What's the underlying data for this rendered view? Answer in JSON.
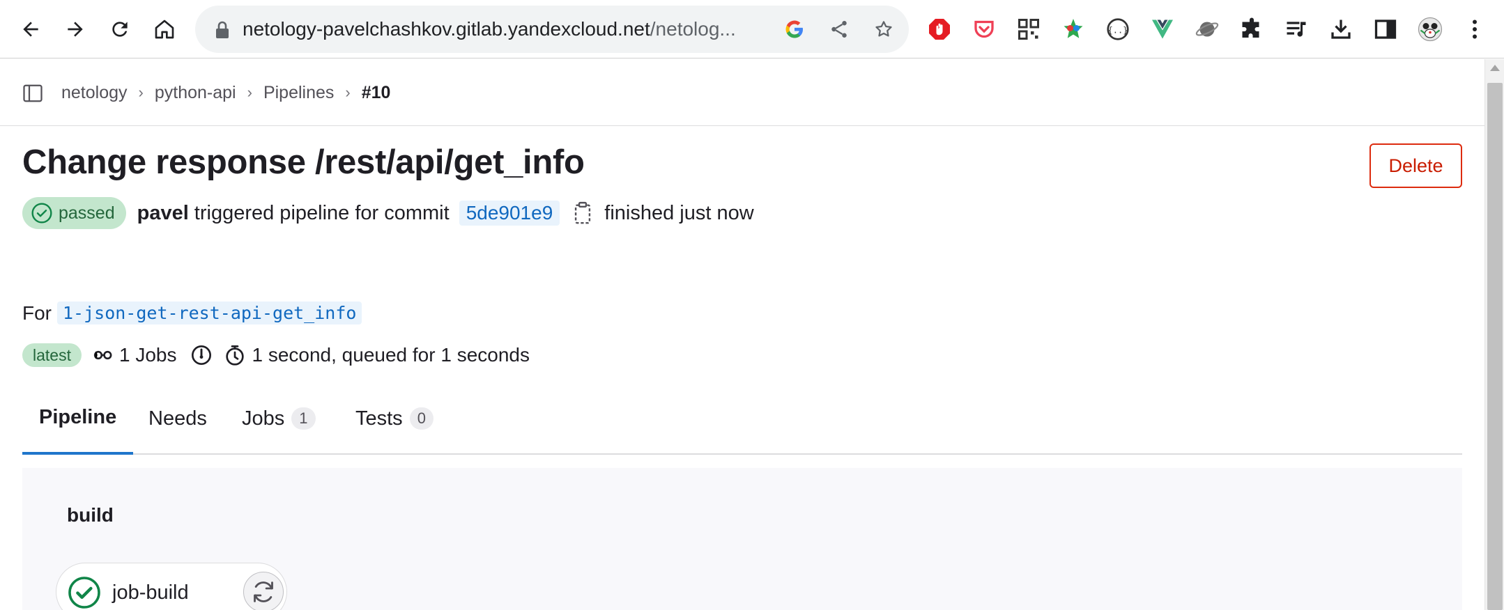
{
  "browser": {
    "url_host": "netology-pavelchashkov.gitlab.yandexcloud.net",
    "url_path": "/netolog..."
  },
  "breadcrumb": {
    "items": [
      "netology",
      "python-api",
      "Pipelines"
    ],
    "current": "#10"
  },
  "header": {
    "title": "Change response /rest/api/get_info",
    "delete_label": "Delete"
  },
  "pipeline_meta": {
    "status": "passed",
    "user": "pavel",
    "triggered_text": "triggered pipeline for commit",
    "commit_sha": "5de901e9",
    "finished_text": "finished just now"
  },
  "branch": {
    "prefix": "For",
    "name": "1-json-get-rest-api-get_info"
  },
  "info": {
    "latest_label": "latest",
    "jobs_text": "1 Jobs",
    "duration_text": "1 second, queued for 1 seconds"
  },
  "tabs": [
    {
      "label": "Pipeline",
      "count": null,
      "active": true
    },
    {
      "label": "Needs",
      "count": null,
      "active": false
    },
    {
      "label": "Jobs",
      "count": "1",
      "active": false
    },
    {
      "label": "Tests",
      "count": "0",
      "active": false
    }
  ],
  "graph": {
    "stage": "build",
    "job": {
      "name": "job-build",
      "status": "success"
    }
  },
  "colors": {
    "accent": "#1f75cb",
    "success": "#108548",
    "danger": "#dd2b0e"
  },
  "icons": {
    "omnibox": [
      "google-icon",
      "share-icon",
      "star-icon"
    ],
    "extensions": [
      "adblock-icon",
      "pocket-icon",
      "qr-icon",
      "color-picker-icon",
      "json-viewer-icon",
      "vue-devtools-icon",
      "planet-icon",
      "puzzle-icon",
      "media-icon",
      "download-icon",
      "side-panel-icon",
      "profile-avatar",
      "menu-dots-icon"
    ]
  }
}
